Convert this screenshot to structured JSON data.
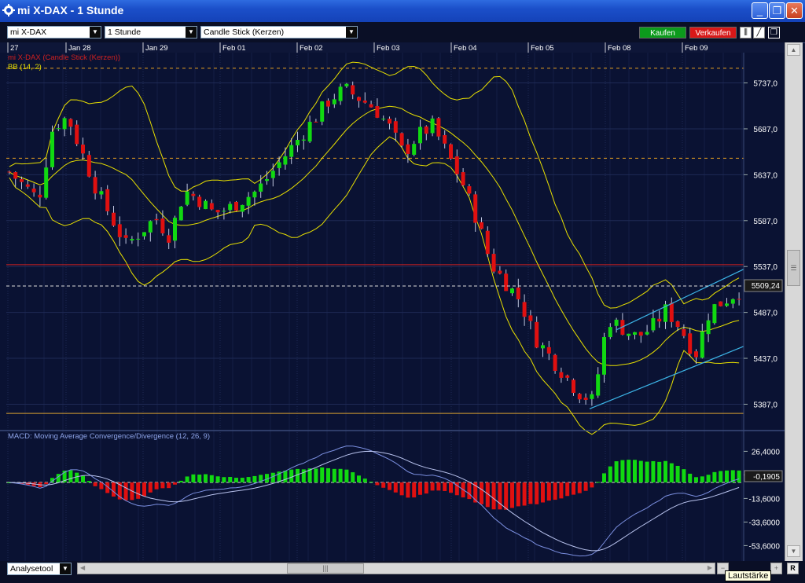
{
  "window": {
    "title": "mi X-DAX - 1 Stunde"
  },
  "toolbar": {
    "symbol": "mi X-DAX",
    "interval": "1 Stunde",
    "chart_type": "Candle Stick (Kerzen)",
    "buy_label": "Kaufen",
    "sell_label": "Verkaufen"
  },
  "legend": {
    "series": "mi X-DAX (Candle Stick (Kerzen))",
    "bb": "BB (14, 2)"
  },
  "price_axis": [
    "5737,0",
    "5687,0",
    "5637,0",
    "5587,0",
    "5537,0",
    "5487,0",
    "5437,0",
    "5387,0"
  ],
  "current_price": "5509,24",
  "date_labels": [
    "27",
    "Jan 28",
    "Jan 29",
    "Feb 01",
    "Feb 02",
    "Feb 03",
    "Feb 04",
    "Feb 05",
    "Feb 08",
    "Feb 09"
  ],
  "macd": {
    "title": "MACD: Moving Average Convergence/Divergence (12, 26, 9)",
    "axis": [
      "26,4000",
      "6,4000",
      "-13,6000",
      "-33,6000",
      "-53,6000"
    ],
    "current": "-0,1905"
  },
  "bottom": {
    "tool_label": "Analysetool",
    "r_label": "R"
  },
  "tooltip": "Lautstärke",
  "colors": {
    "bull": "#11d911",
    "bear": "#e01010",
    "bb": "#e8e000",
    "trend": "#3cb4e6",
    "background": "#0a1233"
  },
  "chart_data": {
    "type": "candlestick",
    "interval": "1 Stunde",
    "x_dates": [
      "Jan 28",
      "Jan 29",
      "Feb 01",
      "Feb 02",
      "Feb 03",
      "Feb 04",
      "Feb 05",
      "Feb 08",
      "Feb 09"
    ],
    "ylim": [
      5360,
      5770
    ],
    "close_path": [
      5640,
      5625,
      5610,
      5690,
      5700,
      5660,
      5620,
      5590,
      5560,
      5575,
      5590,
      5570,
      5620,
      5610,
      5595,
      5600,
      5610,
      5620,
      5640,
      5660,
      5680,
      5700,
      5720,
      5730,
      5720,
      5710,
      5690,
      5660,
      5680,
      5690,
      5660,
      5630,
      5590,
      5540,
      5520,
      5500,
      5460,
      5440,
      5420,
      5400,
      5390,
      5480,
      5470,
      5460,
      5470,
      5490,
      5470,
      5440,
      5490,
      5500,
      5510
    ],
    "horizontal_lines": [
      5753,
      5655,
      5539,
      5377
    ],
    "trend_channel": {
      "upper": [
        [
          5468,
          5534
        ]
      ],
      "lower": [
        [
          5382,
          5450
        ]
      ]
    },
    "macd_ylim": [
      -60,
      36
    ]
  }
}
